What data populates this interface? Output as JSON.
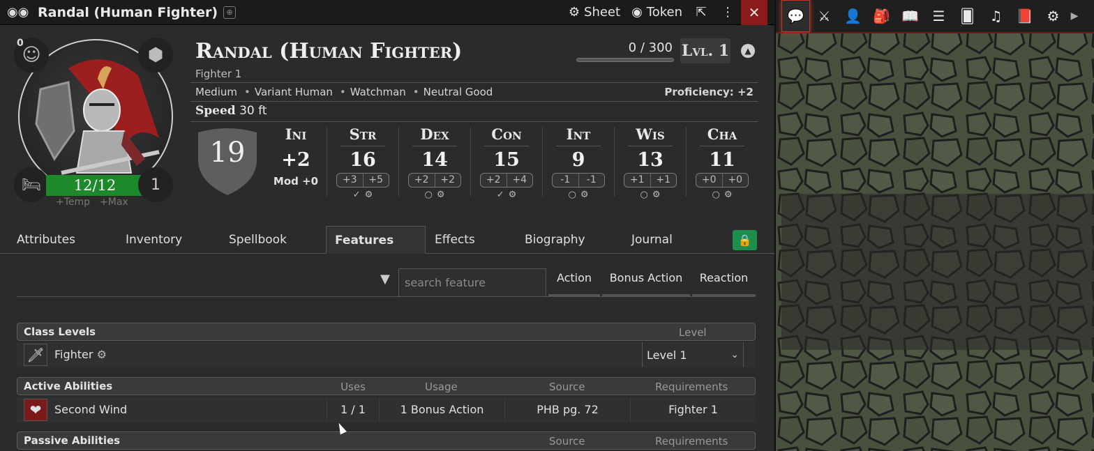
{
  "window": {
    "title": "Randal (Human Fighter)",
    "sheet_label": "Sheet",
    "token_label": "Token"
  },
  "header": {
    "inspiration_count": "0",
    "hp": "12/12",
    "hit_dice": "1",
    "hp_temp": "+Temp",
    "hp_max": "+Max",
    "name": "Randal (Human Fighter)",
    "class_line": "Fighter 1",
    "xp": "0 / 300",
    "xp_fraction": 0,
    "level": "Lvl. 1",
    "details": [
      "Medium",
      "Variant Human",
      "Watchman",
      "Neutral Good"
    ],
    "proficiency": "Proficiency: +2",
    "speed_label": "Speed",
    "speed_value": "30 ft",
    "ac": "19"
  },
  "initiative": {
    "name": "Ini",
    "value": "+2",
    "mod": "Mod +0"
  },
  "abilities": [
    {
      "name": "Str",
      "value": "16",
      "mod": "+3",
      "save": "+5",
      "proficient": true
    },
    {
      "name": "Dex",
      "value": "14",
      "mod": "+2",
      "save": "+2",
      "proficient": false
    },
    {
      "name": "Con",
      "value": "15",
      "mod": "+2",
      "save": "+4",
      "proficient": true
    },
    {
      "name": "Int",
      "value": "9",
      "mod": "-1",
      "save": "-1",
      "proficient": false
    },
    {
      "name": "Wis",
      "value": "13",
      "mod": "+1",
      "save": "+1",
      "proficient": false
    },
    {
      "name": "Cha",
      "value": "11",
      "mod": "+0",
      "save": "+0",
      "proficient": false
    }
  ],
  "tabs": [
    {
      "label": "Attributes"
    },
    {
      "label": "Inventory"
    },
    {
      "label": "Spellbook"
    },
    {
      "label": "Features"
    },
    {
      "label": "Effects"
    },
    {
      "label": "Biography"
    },
    {
      "label": "Journal"
    }
  ],
  "filters": {
    "search_placeholder": "search feature",
    "action": "Action",
    "bonus_action": "Bonus Action",
    "reaction": "Reaction"
  },
  "class_levels": {
    "title": "Class Levels",
    "col_level": "Level",
    "rows": [
      {
        "name": "Fighter",
        "level": "Level 1"
      }
    ]
  },
  "active_abilities": {
    "title": "Active Abilities",
    "col_uses": "Uses",
    "col_usage": "Usage",
    "col_source": "Source",
    "col_requirements": "Requirements",
    "rows": [
      {
        "name": "Second Wind",
        "uses": "1 / 1",
        "usage": "1 Bonus Action",
        "source": "PHB pg. 72",
        "requirements": "Fighter 1"
      }
    ]
  },
  "passive_abilities": {
    "title": "Passive Abilities",
    "col_source": "Source",
    "col_requirements": "Requirements"
  },
  "colors": {
    "hp_bar": "#1c8a2a",
    "lock_button": "#1e8e4f",
    "close_button": "#8b1a1a",
    "active_sidebar_glow": "#c0392b"
  }
}
